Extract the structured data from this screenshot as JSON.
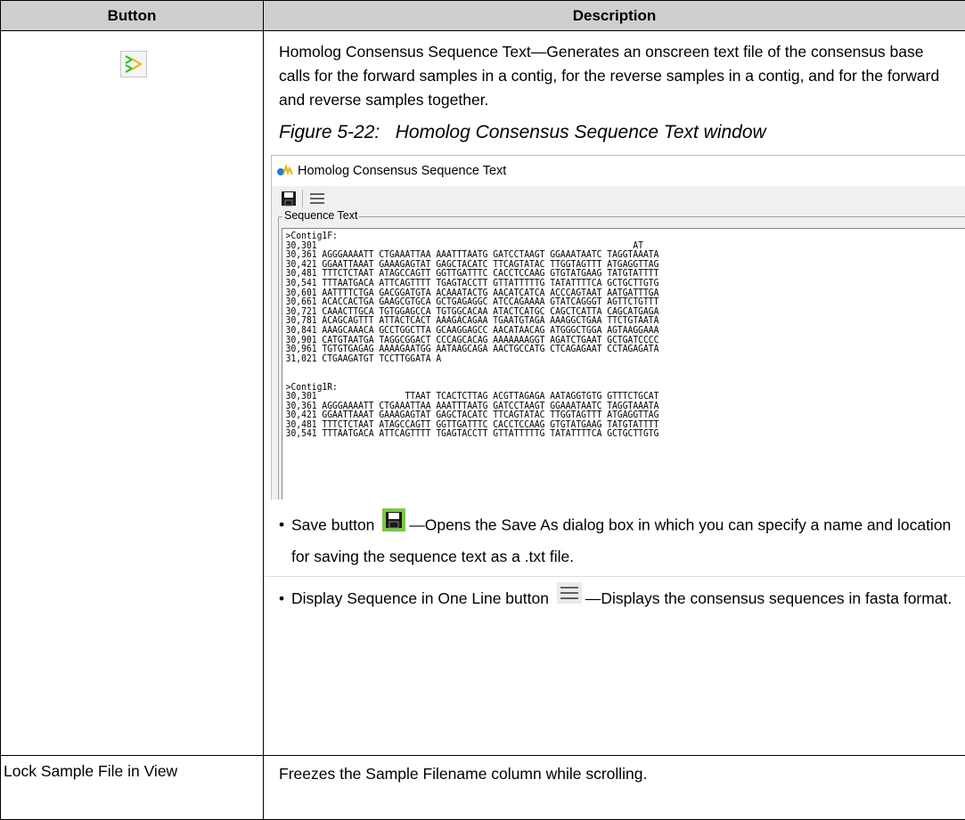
{
  "table": {
    "headers": [
      "Button",
      "Description"
    ]
  },
  "row1": {
    "icon": "homolog-consensus-icon",
    "description": "Homolog Consensus Sequence Text—Generates an onscreen text file of the consensus base calls for the forward samples in a contig, for the reverse samples in a contig, and for the forward and reverse samples together.",
    "figure_caption": "Figure 5-22:   Homolog Consensus Sequence Text window",
    "window": {
      "title": "Homolog Consensus Sequence Text",
      "toolbar_icons": [
        "save-icon",
        "one-line-icon"
      ],
      "group_label": "Sequence Text",
      "sequence_text": ">Contig1F:\n30,301                                                             AT\n30,361 AGGGAAAATT CTGAAATTAA AAATTTAATG GATCCTAAGT GGAAATAATC TAGGTAAATA\n30,421 GGAATTAAAT GAAAGAGTAT GAGCTACATC TTCAGTATAC TTGGTAGTTT ATGAGGTTAG\n30,481 TTTCTCTAAT ATAGCCAGTT GGTTGATTTC CACCTCCAAG GTGTATGAAG TATGTATTTT\n30,541 TTTAATGACA ATTCAGTTTT TGAGTACCTT GTTATTTTTG TATATTTTCA GCTGCTTGTG\n30,601 AATTTTCTGA GACGGATGTA ACAAATACTG AACATCATCA ACCCAGTAAT AATGATTTGA\n30,661 ACACCACTGA GAAGCGTGCA GCTGAGAGGC ATCCAGAAAA GTATCAGGGT AGTTCTGTTT\n30,721 CAAACTTGCA TGTGGAGCCA TGTGGCACAA ATACTCATGC CAGCTCATTA CAGCATGAGA\n30,781 ACAGCAGTTT ATTACTCACT AAAGACAGAA TGAATGTAGA AAAGGCTGAA TTCTGTAATA\n30,841 AAAGCAAACA GCCTGGCTTA GCAAGGAGCC AACATAACAG ATGGGCTGGA AGTAAGGAAA\n30,901 CATGTAATGA TAGGCGGACT CCCAGCACAG AAAAAAAGGT AGATCTGAAT GCTGATCCCC\n30,961 TGTGTGAGAG AAAAGAATGG AATAAGCAGA AACTGCCATG CTCAGAGAAT CCTAGAGATA\n31,021 CTGAAGATGT TCCTTGGATA A\n\n\n>Contig1R:\n30,301                 TTAAT TCACTCTTAG ACGTTAGAGA AATAGGTGTG GTTTCTGCAT\n30,361 AGGGAAAATT CTGAAATTAA AAATTTAATG GATCCTAAGT GGAAATAATC TAGGTAAATA\n30,421 GGAATTAAAT GAAAGAGTAT GAGCTACATC TTCAGTATAC TTGGTAGTTT ATGAGGTTAG\n30,481 TTTCTCTAAT ATAGCCAGTT GGTTGATTTC CACCTCCAAG GTGTATGAAG TATGTATTTT\n30,541 TTTAATGACA ATTCAGTTTT TGAGTACCTT GTTATTTTTG TATATTTTCA GCTGCTTGTG"
    },
    "bullet_save_label": "Save button",
    "bullet_save_text": "—Opens the Save As dialog box in which you can specify a name and location for saving the sequence text as a .txt file.",
    "bullet_oneline_label": "Display Sequence in One Line button",
    "bullet_oneline_text": "—Displays the consensus sequences in fasta format."
  },
  "row2": {
    "button_label": "Lock Sample File in View",
    "description": "Freezes the Sample Filename column while scrolling."
  },
  "colors": {
    "header_bg": "#cfcfcf",
    "save_icon_bg": "#7ac943",
    "accent_green": "#22c322",
    "accent_yellow": "#f0b400"
  }
}
